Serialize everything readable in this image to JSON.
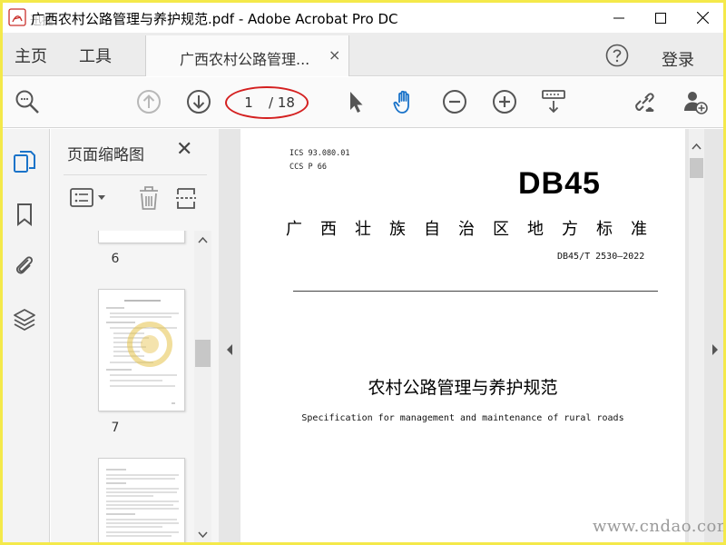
{
  "window": {
    "title": "广西农村公路管理与养护规范.pdf - Adobe Acrobat Pro DC",
    "minimize_icon": "minimize-icon",
    "maximize_icon": "maximize-icon",
    "close_icon": "close-icon"
  },
  "tabs": {
    "home": "主页",
    "tools": "工具",
    "document_tab": "广西农村公路管理...",
    "document_tab_close": "×",
    "help_icon": "help-icon",
    "login": "登录"
  },
  "toolbar": {
    "current_page": "1",
    "total_pages": "/ 18",
    "items": [
      "search-zoom-icon",
      "page-up-icon",
      "page-down-icon",
      "select-cursor-icon",
      "hand-tool-icon",
      "zoom-out-icon",
      "zoom-in-icon",
      "page-display-icon",
      "share-link-icon",
      "add-user-icon"
    ],
    "accent_color": "#1a73c9",
    "highlight_oval_color": "#d42020"
  },
  "sidebar": {
    "rail_icons": [
      "page-thumbnails-icon",
      "bookmarks-icon",
      "attachments-icon",
      "layers-icon"
    ],
    "panel_title": "页面缩略图",
    "panel_close": "✕",
    "thumbnails": [
      {
        "page_label": "6"
      },
      {
        "page_label": "7"
      },
      {
        "page_label": ""
      }
    ]
  },
  "document": {
    "ics": "ICS  93.080.01",
    "ccs": "CCS  P 66",
    "db_code": "DB45",
    "standard_title": "广西壮族自治区地方标准",
    "standard_number": "DB45/T 2530—2022",
    "title_cn": "农村公路管理与养护规范",
    "title_en": "Specification for management and maintenance of rural roads"
  },
  "watermark": {
    "bottom_right": "www.cndao.com",
    "top_left": "迅捷"
  }
}
